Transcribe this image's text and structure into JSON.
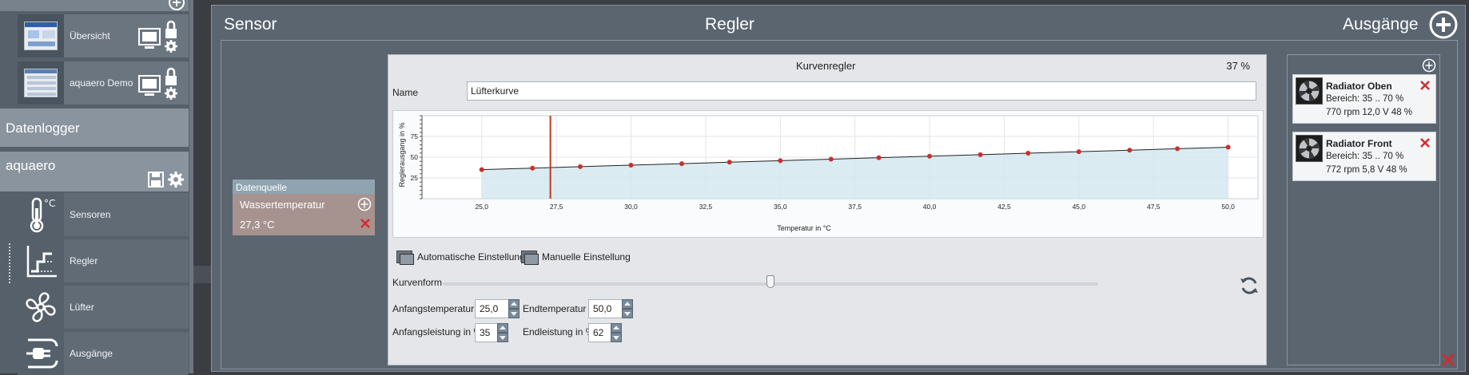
{
  "sidebar": {
    "items": [
      {
        "label": "Übersicht"
      },
      {
        "label": "aquaero Demo"
      }
    ],
    "sections": {
      "datalogger": "Datenlogger",
      "device": "aquaero"
    },
    "nav": [
      {
        "label": "Sensoren",
        "icon": "thermometer-icon"
      },
      {
        "label": "Regler",
        "icon": "controller-icon"
      },
      {
        "label": "Lüfter",
        "icon": "fan-icon"
      },
      {
        "label": "Ausgänge",
        "icon": "plug-icon"
      }
    ]
  },
  "header": {
    "sensor": "Sensor",
    "regler": "Regler",
    "ausgaenge": "Ausgänge"
  },
  "datasource": {
    "title": "Datenquelle",
    "name": "Wassertemperatur",
    "value": "27,3 °C"
  },
  "controller": {
    "title": "Kurvenregler",
    "percent": "37 %",
    "name_label": "Name",
    "name_value": "Lüfterkurve",
    "auto_label": "Automatische Einstellung",
    "manual_label": "Manuelle Einstellung",
    "curve_label": "Kurvenform",
    "curve_shape": 0.5,
    "start_temp_label": "Anfangstemperatur",
    "start_temp_value": "25,0",
    "end_temp_label": "Endtemperatur",
    "end_temp_value": "50,0",
    "start_power_label": "Anfangsleistung in %",
    "start_power_value": "35",
    "end_power_label": "Endleistung in %",
    "end_power_value": "62"
  },
  "chart_data": {
    "type": "line",
    "xlabel": "Temperatur in °C",
    "ylabel": "Reglerausgang in %",
    "xlim": [
      23,
      51
    ],
    "ylim": [
      0,
      100
    ],
    "xticks": [
      "25,0",
      "27,5",
      "30,0",
      "32,5",
      "35,0",
      "37,5",
      "40,0",
      "42,5",
      "45,0",
      "47,5",
      "50,0"
    ],
    "yticks": [
      "25",
      "50",
      "75"
    ],
    "x": [
      25.0,
      26.7,
      28.3,
      30.0,
      31.7,
      33.3,
      35.0,
      36.7,
      38.3,
      40.0,
      41.7,
      43.3,
      45.0,
      46.7,
      48.3,
      50.0
    ],
    "y": [
      35.0,
      36.8,
      38.6,
      40.4,
      42.2,
      44.0,
      45.8,
      47.6,
      49.4,
      51.2,
      53.0,
      54.8,
      56.6,
      58.4,
      60.2,
      62.0
    ],
    "marker_x": 27.3,
    "colors": {
      "line": "#222222",
      "point": "#c9302c",
      "area": "#d3e8f0",
      "marker": "#c0391b"
    }
  },
  "outputs": [
    {
      "name": "Radiator Oben",
      "range": "Bereich:  35 .. 70  %",
      "stats": "770 rpm  12,0 V  48 %"
    },
    {
      "name": "Radiator Front",
      "range": "Bereich:  35 .. 70  %",
      "stats": "772 rpm  5,8 V  48 %"
    }
  ]
}
